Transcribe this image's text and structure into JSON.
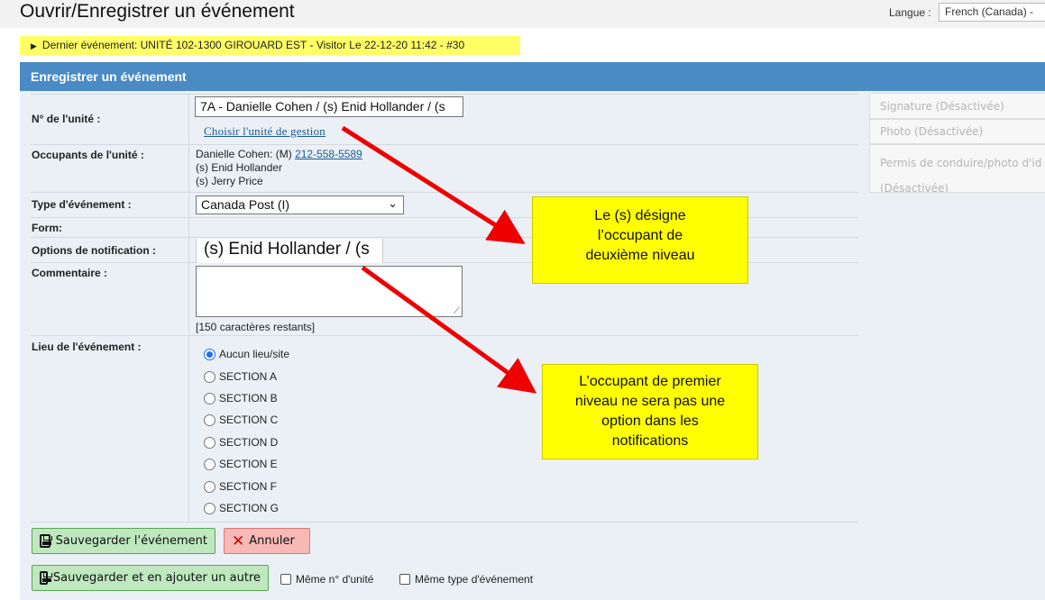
{
  "header": {
    "title": "Ouvrir/Enregistrer un événement",
    "language_label": "Langue :",
    "language_value": "French (Canada) -"
  },
  "last_event": {
    "text": "Dernier événement: UNITÉ 102-1300 GIROUARD EST - Visitor Le 22-12-20 11:42 - #30"
  },
  "panel": {
    "title": "Enregistrer un événement"
  },
  "form": {
    "unit_label": "N° de l'unité :",
    "unit_value": "7A - Danielle Cohen / (s) Enid Hollander / (s",
    "choose_unit_link": "Choisir l'unité de gestion",
    "occupants_label": "Occupants de l'unité :",
    "occupant_1_prefix": "Danielle Cohen: (M)",
    "occupant_1_phone": "212-558-5589",
    "occupant_2": "(s) Enid Hollander",
    "occupant_3": "(s) Jerry Price",
    "event_type_label": "Type d'événement :",
    "event_type_value": "Canada Post (I)",
    "form_label": "Form:",
    "notification_label": "Options de notification :",
    "notification_value": "(s) Enid Hollander / (s",
    "comment_label": "Commentaire :",
    "chars_left": "[150 caractères restants]",
    "location_label": "Lieu de l'événement :",
    "locations": [
      "Aucun lieu/site",
      "SECTION A",
      "SECTION B",
      "SECTION C",
      "SECTION D",
      "SECTION E",
      "SECTION F",
      "SECTION G"
    ],
    "selected_location": "Aucun lieu/site"
  },
  "buttons": {
    "save": "Sauvegarder l'événement",
    "cancel": "Annuler",
    "save_and_add": "Sauvegarder et en ajouter un autre",
    "same_unit": "Même n° d'unité",
    "same_event_type": "Même type d'événement"
  },
  "side_panel": {
    "signature": "Signature (Désactivée)",
    "photo": "Photo (Désactivée)",
    "license": "Permis de conduire/photo d'id",
    "license_disabled": "(Désactivée)"
  },
  "callouts": {
    "second_level": [
      "Le (s) désigne",
      "l’occupant de",
      "deuxième niveau"
    ],
    "first_level": [
      "L’occupant de premier",
      "niveau ne sera pas une",
      "option dans les",
      "notifications"
    ]
  },
  "colors": {
    "header_blue": "#4a8bc6",
    "panel_bg": "#ebf0f6",
    "highlight_yellow": "#ffff00",
    "arrow_red": "#ee0000",
    "save_green": "#bfe8bf",
    "cancel_red": "#f6b9b5"
  },
  "icons": {
    "save": "floppy-disk-icon",
    "cancel": "close-x-icon",
    "dropdown": "chevron-down-icon",
    "expand": "triangle-right-icon"
  }
}
